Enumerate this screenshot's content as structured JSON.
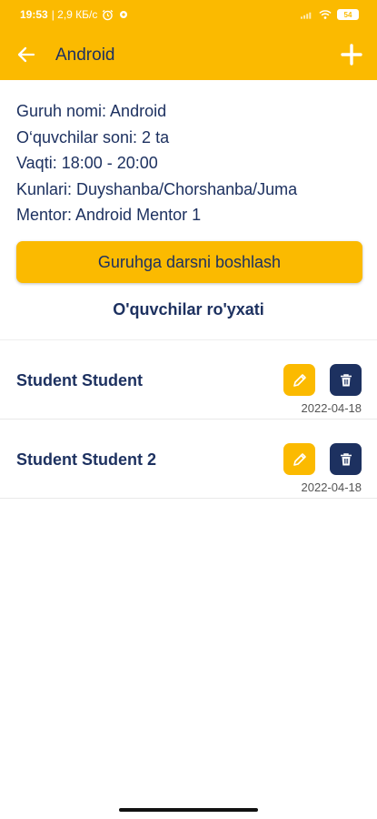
{
  "status_bar": {
    "time": "19:53",
    "network_speed": "| 2,9 КБ/с",
    "battery_level": "54",
    "icons": [
      "alarm-icon",
      "settings-icon",
      "signal-icon",
      "wifi-icon",
      "battery-icon"
    ]
  },
  "app_bar": {
    "title": "Android",
    "back_icon": "arrow-left-icon",
    "add_icon": "plus-icon"
  },
  "group_info": {
    "name": "Guruh nomi: Android",
    "students_count": "O‘quvchilar soni: 2 ta",
    "time": "Vaqti: 18:00 - 20:00",
    "days": "Kunlari: Duyshanba/Chorshanba/Juma",
    "mentor": "Mentor: Android Mentor 1"
  },
  "start_button_label": "Guruhga darsni boshlash",
  "students_list_title": "O'quvchilar ro'yxati",
  "students": [
    {
      "name": "Student Student",
      "date": "2022-04-18"
    },
    {
      "name": "Student Student 2",
      "date": "2022-04-18"
    }
  ],
  "colors": {
    "accent": "#FBBA00",
    "primary_text": "#1D3160",
    "background": "#FFFFFF"
  }
}
